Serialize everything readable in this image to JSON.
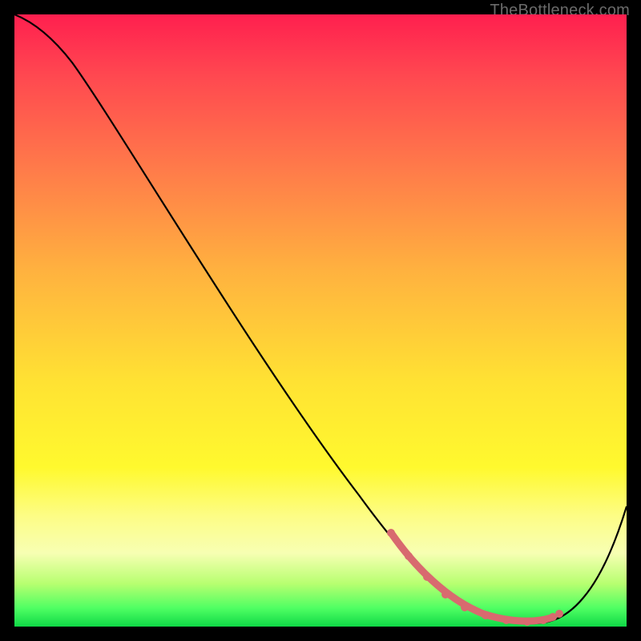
{
  "watermark": "TheBottleneck.com",
  "colors": {
    "page_bg": "#000000",
    "gradient_stops": [
      "#ff1f4f",
      "#ff4850",
      "#ff7a4a",
      "#ffb23f",
      "#ffe233",
      "#fff92e",
      "#fdfd86",
      "#f7ffb3",
      "#b7ff70",
      "#4fff63",
      "#0fd846"
    ],
    "curve": "#000000",
    "marker": "#d86a6f"
  },
  "chart_data": {
    "type": "line",
    "title": "",
    "xlabel": "",
    "ylabel": "",
    "xlim": [
      0,
      100
    ],
    "ylim": [
      0,
      100
    ],
    "series": [
      {
        "name": "background-gradient-value",
        "note": "vertical gradient encodes value 0→100 top→bottom (red→green)"
      },
      {
        "name": "curve",
        "x": [
          0,
          3,
          8,
          14,
          20,
          26,
          32,
          38,
          44,
          50,
          56,
          60,
          63,
          67,
          72,
          77,
          82,
          86,
          88,
          92,
          96,
          100
        ],
        "y": [
          100,
          99,
          97,
          93,
          87,
          80,
          72,
          64,
          56,
          48,
          40,
          34,
          28,
          20,
          11,
          5,
          2,
          1,
          1,
          3,
          9,
          19
        ],
        "note": "y is percent height from bottom; approximated from pixels"
      },
      {
        "name": "valley-markers",
        "type": "scatter",
        "x": [
          62,
          65,
          68,
          71,
          74,
          77,
          80,
          83,
          86,
          88,
          89
        ],
        "y": [
          24,
          18,
          12,
          8,
          5,
          3,
          2,
          1.5,
          1.5,
          2,
          3
        ]
      }
    ]
  }
}
